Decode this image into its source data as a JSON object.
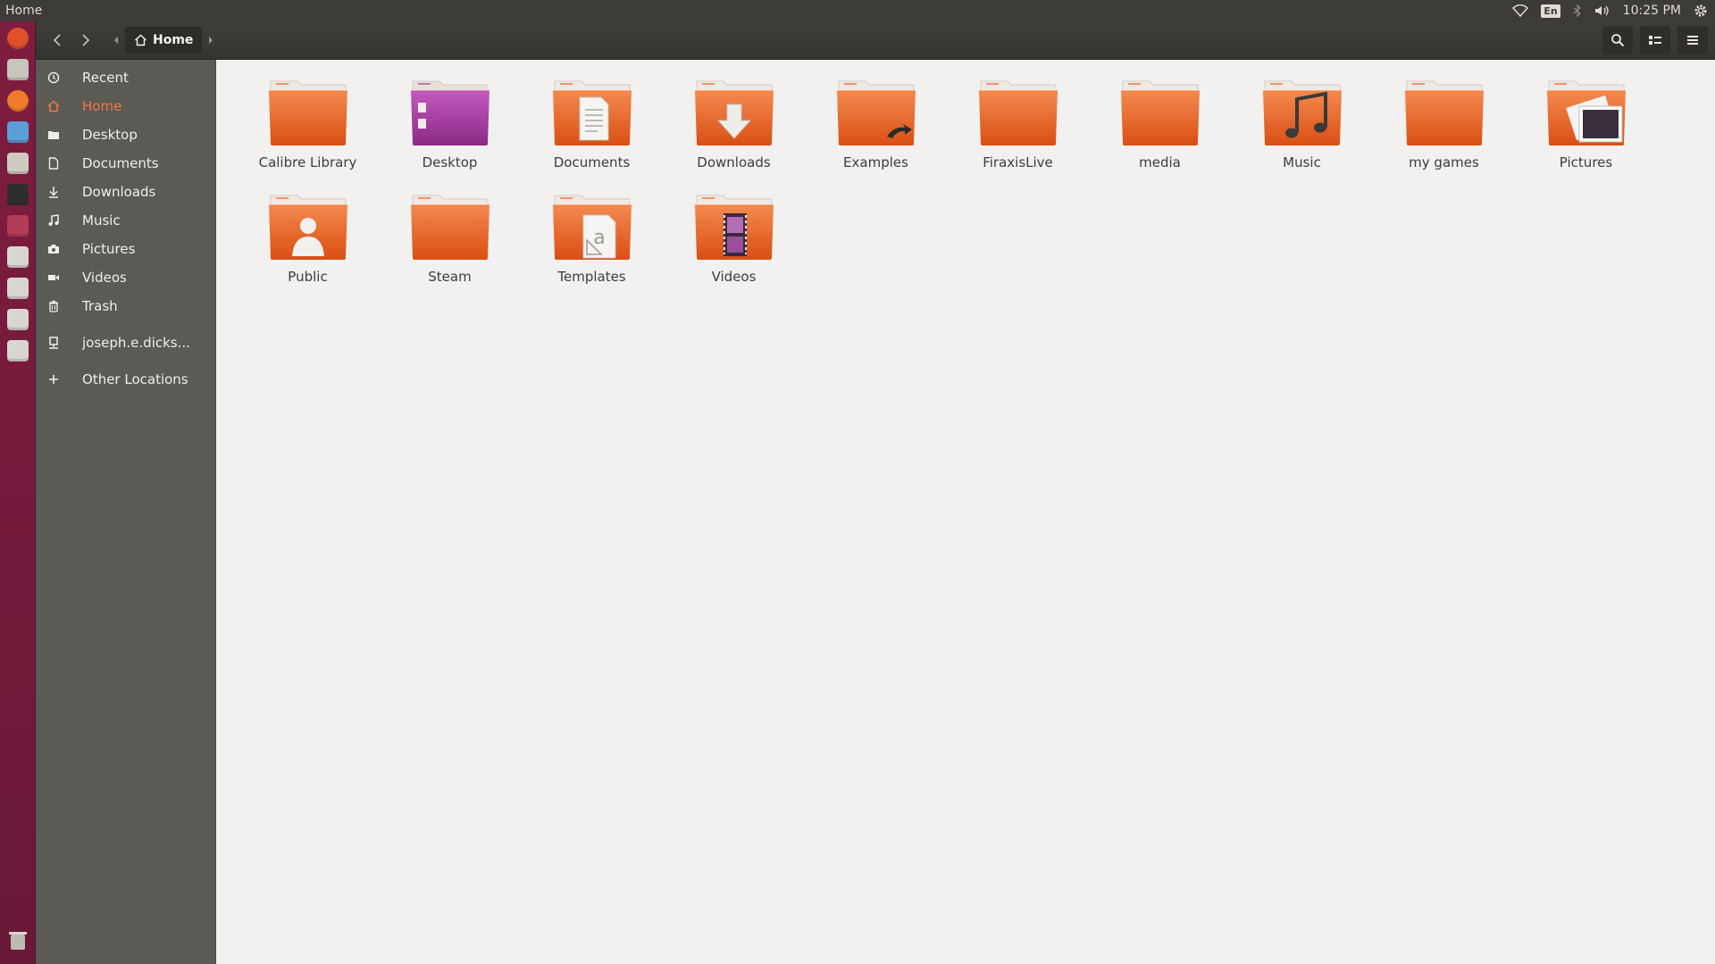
{
  "window": {
    "title": "Home"
  },
  "indicators": {
    "lang": "En",
    "clock": "10:25 PM"
  },
  "launcher": [
    {
      "name": "ubuntu-dash-icon",
      "color": "#e2502a"
    },
    {
      "name": "files-icon",
      "color": "#c9c6bf"
    },
    {
      "name": "firefox-icon",
      "color": "#ef7c2a"
    },
    {
      "name": "screenshot-icon",
      "color": "#5d9ed8"
    },
    {
      "name": "settings-icon",
      "color": "#cfcbc3"
    },
    {
      "name": "terminal-icon",
      "color": "#2e2e2e"
    },
    {
      "name": "software-icon",
      "color": "#b33c58"
    },
    {
      "name": "drive-icon",
      "color": "#d8d6d2"
    },
    {
      "name": "drive-icon",
      "color": "#d8d6d2"
    },
    {
      "name": "drive-icon",
      "color": "#d8d6d2"
    },
    {
      "name": "drive-icon",
      "color": "#d8d6d2"
    }
  ],
  "header": {
    "breadcrumb_home": "Home"
  },
  "sidebar": {
    "items": [
      {
        "label": "Recent",
        "icon": "clock-icon"
      },
      {
        "label": "Home",
        "icon": "home-icon",
        "active": true
      },
      {
        "label": "Desktop",
        "icon": "desktop-folder-icon"
      },
      {
        "label": "Documents",
        "icon": "document-icon"
      },
      {
        "label": "Downloads",
        "icon": "download-icon"
      },
      {
        "label": "Music",
        "icon": "music-icon"
      },
      {
        "label": "Pictures",
        "icon": "camera-icon"
      },
      {
        "label": "Videos",
        "icon": "video-icon"
      },
      {
        "label": "Trash",
        "icon": "trash-icon"
      }
    ],
    "network": {
      "label": "joseph.e.dicks...",
      "icon": "network-icon"
    },
    "other": {
      "label": "Other Locations",
      "icon": "plus-icon"
    }
  },
  "files": [
    {
      "label": "Calibre Library",
      "emblem": "none"
    },
    {
      "label": "Desktop",
      "emblem": "desktop"
    },
    {
      "label": "Documents",
      "emblem": "document"
    },
    {
      "label": "Downloads",
      "emblem": "download"
    },
    {
      "label": "Examples",
      "emblem": "link"
    },
    {
      "label": "FiraxisLive",
      "emblem": "none"
    },
    {
      "label": "media",
      "emblem": "none"
    },
    {
      "label": "Music",
      "emblem": "music"
    },
    {
      "label": "my games",
      "emblem": "none"
    },
    {
      "label": "Pictures",
      "emblem": "pictures"
    },
    {
      "label": "Public",
      "emblem": "public"
    },
    {
      "label": "Steam",
      "emblem": "none"
    },
    {
      "label": "Templates",
      "emblem": "templates"
    },
    {
      "label": "Videos",
      "emblem": "video"
    }
  ],
  "colors": {
    "accent": "#f07746",
    "folder_top": "#f48a4f",
    "folder_bottom": "#d94f14",
    "desktop_folder": "#a53a9b"
  }
}
